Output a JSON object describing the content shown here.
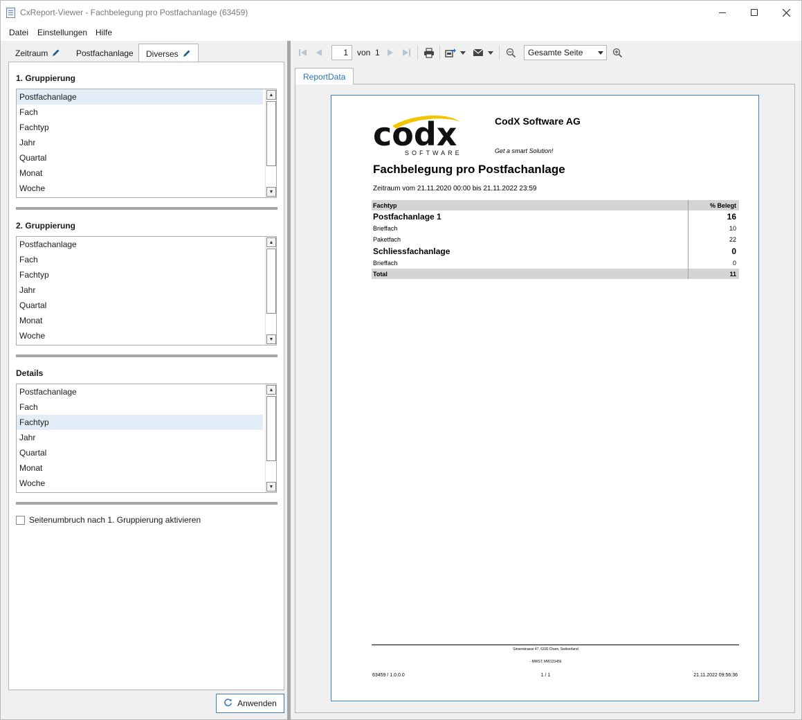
{
  "window": {
    "title": "CxReport-Viewer - Fachbelegung pro Postfachanlage (63459)"
  },
  "menu": {
    "items": [
      "Datei",
      "Einstellungen",
      "Hilfe"
    ]
  },
  "left_tabs": [
    {
      "label": "Zeitraum",
      "editable": true
    },
    {
      "label": "Postfachanlage",
      "editable": false
    },
    {
      "label": "Diverses",
      "editable": true,
      "active": true
    }
  ],
  "groups": [
    {
      "title": "1. Gruppierung",
      "options": [
        "Postfachanlage",
        "Fach",
        "Fachtyp",
        "Jahr",
        "Quartal",
        "Monat",
        "Woche"
      ],
      "selected": "Postfachanlage"
    },
    {
      "title": "2. Gruppierung",
      "options": [
        "Postfachanlage",
        "Fach",
        "Fachtyp",
        "Jahr",
        "Quartal",
        "Monat",
        "Woche"
      ],
      "selected": null
    },
    {
      "title": "Details",
      "options": [
        "Postfachanlage",
        "Fach",
        "Fachtyp",
        "Jahr",
        "Quartal",
        "Monat",
        "Woche"
      ],
      "selected": "Fachtyp"
    }
  ],
  "page_break_checkbox": {
    "label": "Seitenumbruch nach 1. Gruppierung aktivieren",
    "checked": false
  },
  "apply_button": {
    "label": "Anwenden"
  },
  "toolbar": {
    "current_page": "1",
    "of_label": "von",
    "total_pages": "1",
    "zoom_value": "Gesamte Seite"
  },
  "report_tab": {
    "label": "ReportData"
  },
  "report": {
    "company": "CodX Software AG",
    "slogan": "Get a smart Solution!",
    "logo_text": "codx",
    "logo_sub": "SOFTWARE",
    "title": "Fachbelegung pro Postfachanlage",
    "range": "Zeitraum vom 21.11.2020 00:00 bis 21.11.2022 23:59",
    "table": {
      "col1": "Fachtyp",
      "col2": "% Belegt",
      "groups": [
        {
          "name": "Postfachanlage 1",
          "value": "16",
          "items": [
            {
              "name": "Brieffach",
              "value": "10"
            },
            {
              "name": "Paketfach",
              "value": "22"
            }
          ]
        },
        {
          "name": "Schliessfachanlage",
          "value": "0",
          "items": [
            {
              "name": "Brieffach",
              "value": "0"
            }
          ]
        }
      ],
      "total_label": "Total",
      "total_value": "11"
    },
    "footer": {
      "address": "Sinserstrasse 47,  6330 Cham,  Switzerland",
      "vat": "- MWST: MW123456",
      "left": "63459 / 1.0.0.0",
      "mid": "1 / 1",
      "right": "21.11.2022 09:56:36"
    }
  },
  "colors": {
    "accent": "#2b73b8",
    "selection": "#e2edf8",
    "logo_swoosh": "#f2c500"
  }
}
